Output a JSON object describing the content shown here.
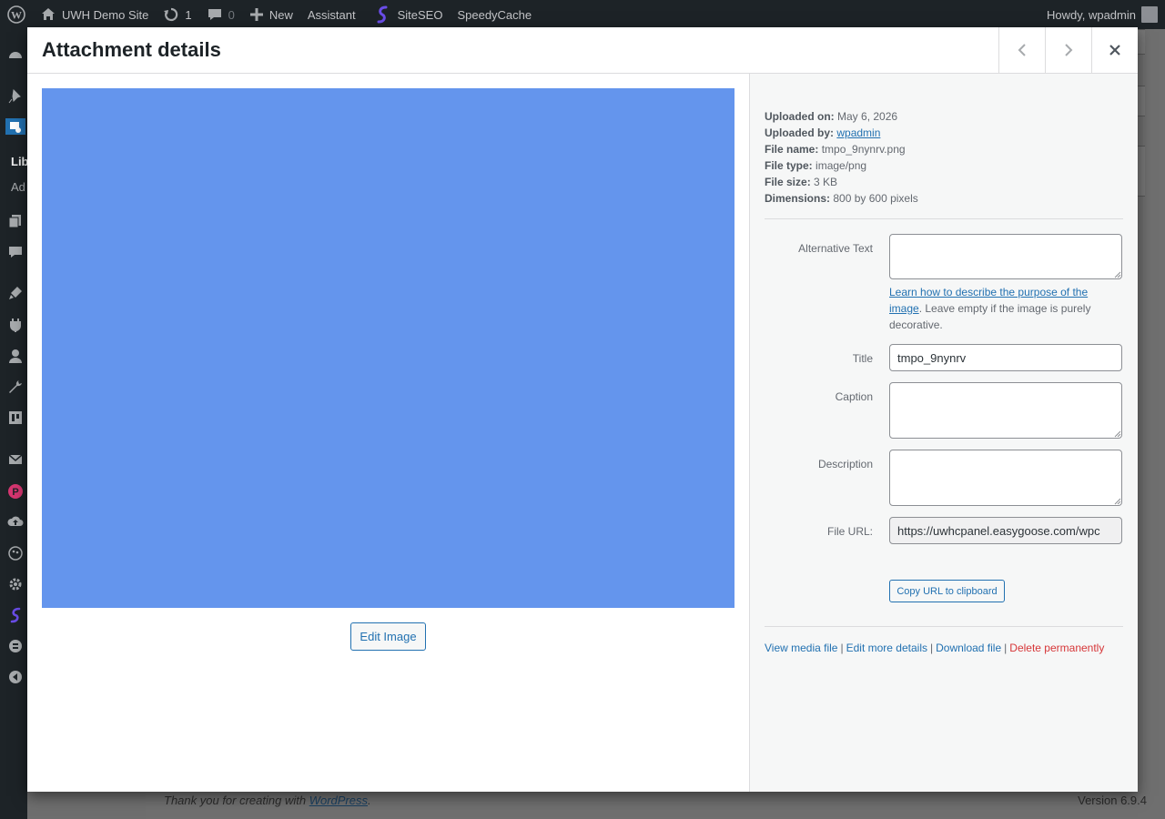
{
  "adminbar": {
    "site_name": "UWH Demo Site",
    "updates_count": "1",
    "comments_count": "0",
    "new_label": "New",
    "assistant_label": "Assistant",
    "siteseo_label": "SiteSEO",
    "speedycache_label": "SpeedyCache",
    "howdy": "Howdy, wpadmin"
  },
  "sidemenu": {
    "partial_labels": [
      "Lib",
      "Ad"
    ]
  },
  "footer": {
    "thanks_prefix": "Thank you for creating with",
    "wordpress_link": "WordPress",
    "period": ".",
    "version": "Version 6.9.4"
  },
  "modal": {
    "title": "Attachment details",
    "prev_icon": "chevron-left-icon",
    "next_icon": "chevron-right-icon",
    "close_icon": "close-icon",
    "edit_image_label": "Edit Image",
    "preview_color": "#6495ed"
  },
  "details": {
    "uploaded_on_label": "Uploaded on:",
    "uploaded_on": "May 6, 2026",
    "uploaded_by_label": "Uploaded by:",
    "uploaded_by": "wpadmin",
    "file_name_label": "File name:",
    "file_name": "tmpo_9nynrv.png",
    "file_type_label": "File type:",
    "file_type": "image/png",
    "file_size_label": "File size:",
    "file_size": "3 KB",
    "dimensions_label": "Dimensions:",
    "dimensions": "800 by 600 pixels"
  },
  "form": {
    "alt_label": "Alternative Text",
    "alt_value": "",
    "alt_hint_link": "Learn how to describe the purpose of the image",
    "alt_hint_text": ". Leave empty if the image is purely decorative.",
    "title_label": "Title",
    "title_value": "tmpo_9nynrv",
    "caption_label": "Caption",
    "caption_value": "",
    "description_label": "Description",
    "description_value": "",
    "url_label": "File URL:",
    "url_value": "https://uwhcpanel.easygoose.com/wpc",
    "copy_label": "Copy URL to clipboard"
  },
  "actions": {
    "view": "View media file",
    "edit_more": "Edit more details",
    "download": "Download file",
    "delete": "Delete permanently",
    "separator": "|"
  }
}
